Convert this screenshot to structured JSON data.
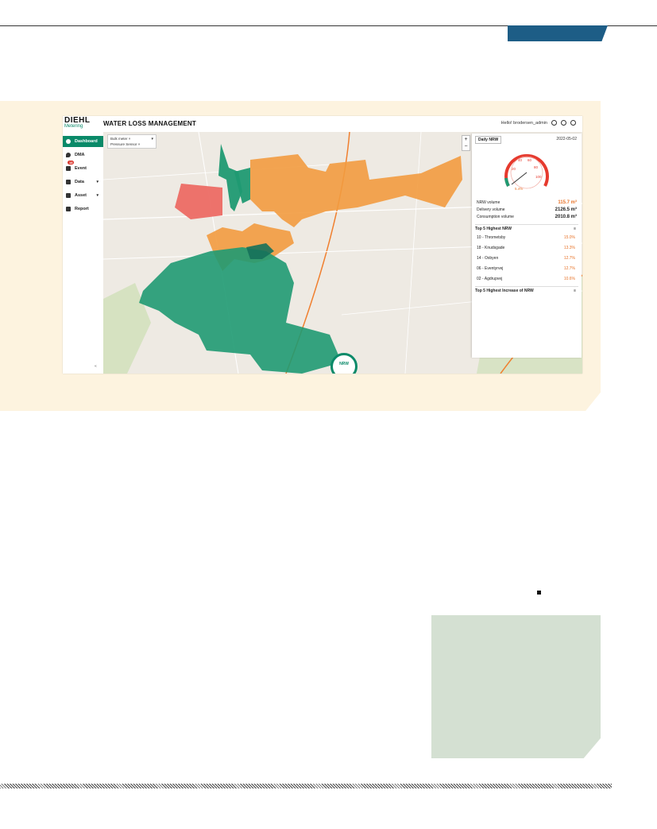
{
  "app": {
    "logo_main": "DIEHL",
    "logo_sub": "Metering",
    "title": "WATER LOSS MANAGEMENT",
    "user_greeting": "Hello! brodersen_admin"
  },
  "sidebar": {
    "items": [
      {
        "label": "Dashboard",
        "icon": "dashboard-icon",
        "active": true
      },
      {
        "label": "DMA",
        "icon": "water-drop-icon"
      },
      {
        "label": "Event",
        "icon": "bell-icon",
        "badge": "18"
      },
      {
        "label": "Data",
        "icon": "data-icon",
        "caret": "▾"
      },
      {
        "label": "Asset",
        "icon": "asset-icon",
        "caret": "▾"
      },
      {
        "label": "Report",
        "icon": "report-icon"
      }
    ],
    "collapse_label": "«"
  },
  "map": {
    "filter_tags": [
      "Bulk meter ×",
      "Pressure Sensor ×"
    ],
    "zoom_in": "+",
    "zoom_out": "−",
    "nrw_badge": "NRW",
    "zone_colors": {
      "green": "#1f9a72",
      "orange": "#f29b3f",
      "red": "#ec6b64"
    }
  },
  "panel": {
    "period": "Daily NRW",
    "date": "2022-05-02",
    "gauge": {
      "value_label": "5.4%",
      "ticks": [
        "20",
        "40",
        "60",
        "80",
        "100"
      ]
    },
    "metrics": [
      {
        "label": "NRW volume",
        "value": "115.7 m³",
        "highlight": true
      },
      {
        "label": "Delivery volume",
        "value": "2126.5 m³"
      },
      {
        "label": "Consumption volume",
        "value": "2010.8 m³"
      }
    ],
    "top5_title": "Top 5 Highest NRW",
    "top5": [
      {
        "name": "10 - Thrometsby",
        "pct": "15.0%"
      },
      {
        "name": "18 - Knudsgade",
        "pct": "13.3%"
      },
      {
        "name": "14 - Oxbyen",
        "pct": "12.7%"
      },
      {
        "name": "06 - Eventyrvej",
        "pct": "12.7%"
      },
      {
        "name": "02 - Agdrupvej",
        "pct": "10.6%"
      }
    ],
    "increase_title": "Top 5 Highest Increase of NRW",
    "collapse_mark": "≡"
  }
}
